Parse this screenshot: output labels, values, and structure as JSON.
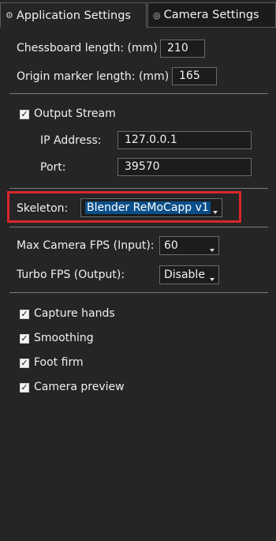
{
  "tabs": [
    {
      "label": "Application Settings",
      "icon": "gear-icon"
    },
    {
      "label": "Camera Settings",
      "icon": "camera-icon"
    }
  ],
  "chessboard": {
    "label": "Chessboard length: (mm)",
    "value": "210"
  },
  "origin_marker": {
    "label": "Origin marker length: (mm)",
    "value": "165"
  },
  "output_stream": {
    "label": "Output Stream",
    "checked": true,
    "ip_label": "IP Address:",
    "ip_value": "127.0.0.1",
    "port_label": "Port:",
    "port_value": "39570"
  },
  "skeleton": {
    "label": "Skeleton:",
    "value": "Blender ReMoCapp v1"
  },
  "max_fps": {
    "label": "Max Camera FPS (Input):",
    "value": "60"
  },
  "turbo_fps": {
    "label": "Turbo FPS (Output):",
    "value": "Disable"
  },
  "options": [
    {
      "label": "Capture hands",
      "checked": true
    },
    {
      "label": "Smoothing",
      "checked": true
    },
    {
      "label": "Foot firm",
      "checked": true
    },
    {
      "label": "Camera preview",
      "checked": true
    }
  ],
  "colors": {
    "background": "#252525",
    "highlight_border": "#d9262b",
    "selection": "#0a4f8a"
  }
}
